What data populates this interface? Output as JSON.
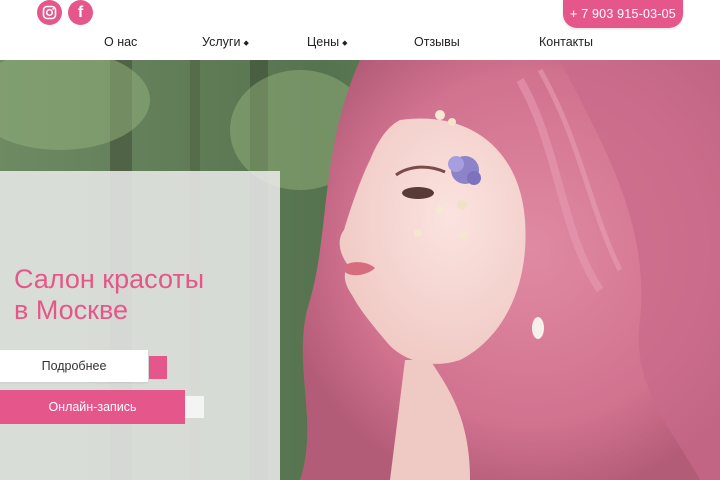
{
  "header": {
    "social": [
      {
        "icon": "instagram-icon"
      },
      {
        "icon": "facebook-icon",
        "glyph": "f"
      }
    ],
    "phone": "+ 7 903 915-03-05",
    "nav": [
      {
        "label": "О нас",
        "has_dropdown": false
      },
      {
        "label": "Услуги",
        "has_dropdown": true
      },
      {
        "label": "Цены",
        "has_dropdown": true
      },
      {
        "label": "Отзывы",
        "has_dropdown": false
      },
      {
        "label": "Контакты",
        "has_dropdown": false
      }
    ],
    "caret_glyph": "◆"
  },
  "hero": {
    "title_line1": "Салон красоты",
    "title_line2": "в Москве",
    "more_button": "Подробнее",
    "book_button": "Онлайн-запись"
  },
  "colors": {
    "accent": "#e5578a",
    "panel": "#ebebeb",
    "text": "#222222"
  }
}
